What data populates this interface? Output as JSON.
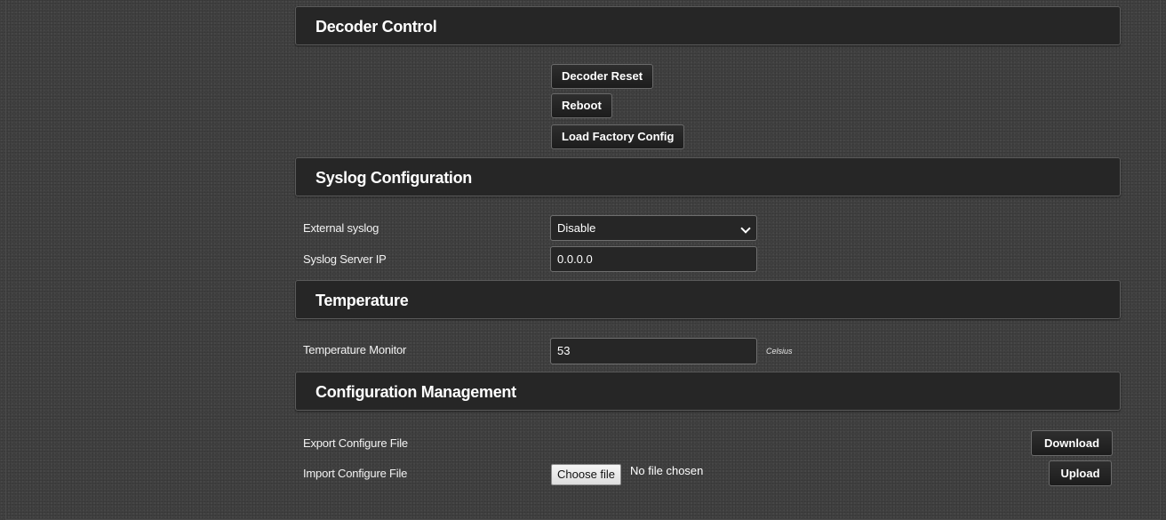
{
  "sections": {
    "decoder_control": {
      "title": "Decoder Control",
      "buttons": {
        "decoder_reset": "Decoder Reset",
        "reboot": "Reboot",
        "load_factory_config": "Load Factory Config"
      }
    },
    "syslog": {
      "title": "Syslog Configuration",
      "external_syslog_label": "External syslog",
      "external_syslog_value": "Disable",
      "server_ip_label": "Syslog Server IP",
      "server_ip_value": "0.0.0.0"
    },
    "temperature": {
      "title": "Temperature",
      "monitor_label": "Temperature Monitor",
      "monitor_value": "53",
      "unit": "Celsius"
    },
    "config_management": {
      "title": "Configuration Management",
      "export_label": "Export Configure File",
      "download_button": "Download",
      "import_label": "Import Configure File",
      "choose_file_button": "Choose file",
      "file_status": "No file chosen",
      "upload_button": "Upload"
    }
  },
  "icons": {
    "select_arrow": "chevron-down-icon"
  },
  "colors": {
    "background": "#404040",
    "header_bg": "#262626",
    "field_bg": "#262626",
    "text": "#ffffff"
  }
}
